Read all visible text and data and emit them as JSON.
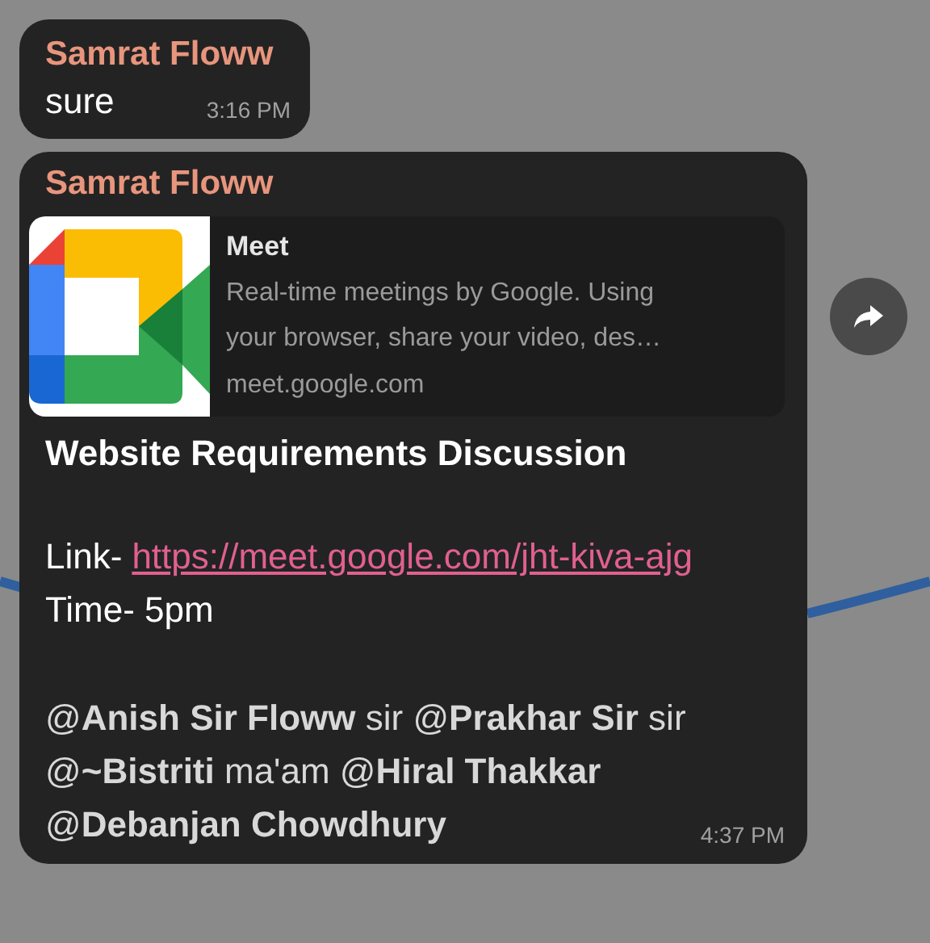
{
  "messages": [
    {
      "kind": "text",
      "sender": "Samrat Floww",
      "text": "sure",
      "time": "3:16 PM"
    },
    {
      "kind": "link_post",
      "sender": "Samrat Floww",
      "preview": {
        "site": "Meet",
        "description": "Real-time meetings by Google. Using\nyour browser, share your video, des…",
        "domain": "meet.google.com"
      },
      "title": "Website Requirements Discussion",
      "link_label": "Link-",
      "link": "https://meet.google.com/jht-kiva-ajg",
      "time_line": "Time- 5pm",
      "mentions": "@**Anish Sir Floww** sir @**Prakhar Sir**  sir\n@**~Bistriti** ma'am @**Hiral Thakkar**\n@**Debanjan Chowdhury**",
      "time": "4:37 PM"
    }
  ]
}
